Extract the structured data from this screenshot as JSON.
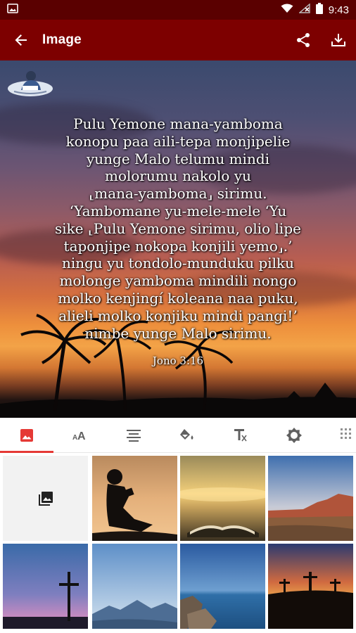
{
  "status_bar": {
    "time": "9:43",
    "icons": [
      "image-notification-icon",
      "wifi-icon",
      "no-signal-icon",
      "battery-icon"
    ]
  },
  "app_bar": {
    "title": "Image",
    "actions": [
      "share-icon",
      "download-icon"
    ]
  },
  "preview": {
    "verse_lines": [
      "Pulu Yemone mana-yamboma",
      "konopu paa aili-tepa monjipelie",
      "yunge Malo telumu mindi",
      "molorumu nakolo yu",
      "⸤mana-yamboma⸥ sirimu.",
      "‘Yambomane yu-mele-mele ‘Yu",
      "sike ⸤Pulu Yemone sirimu, olio lipe",
      "taponjipe nokopa konjili yemo⸥.’",
      "ningu yu tondolo-munduku pilku",
      "molonge yamboma mindili nongo",
      "molko kenjingí koleana naa puku,",
      "alieli molko konjiku mindi pangi!’",
      "nimbe yunge Malo sirimu."
    ],
    "reference": "Jono 3:16"
  },
  "tabs": [
    {
      "name": "background-image",
      "icon": "image-icon",
      "active": true
    },
    {
      "name": "font",
      "icon": "font-size-icon",
      "active": false
    },
    {
      "name": "align",
      "icon": "align-text-icon",
      "active": false
    },
    {
      "name": "color",
      "icon": "paint-bucket-icon",
      "active": false
    },
    {
      "name": "text-style",
      "icon": "text-format-icon",
      "active": false
    },
    {
      "name": "filter",
      "icon": "brightness-icon",
      "active": false
    },
    {
      "name": "texture",
      "icon": "texture-icon",
      "active": false
    }
  ],
  "gallery": {
    "add_icon": "photo-library-icon",
    "images": [
      "boy-reading-silhouette",
      "open-bible-sunset",
      "desert-mesa",
      "cross-twilight",
      "misty-mountains",
      "lake-rocks",
      "three-crosses-sunset"
    ]
  },
  "colors": {
    "status_bar": "#5a0000",
    "app_bar": "#7d0000",
    "accent": "#e53935",
    "tab_icon": "#606060"
  }
}
